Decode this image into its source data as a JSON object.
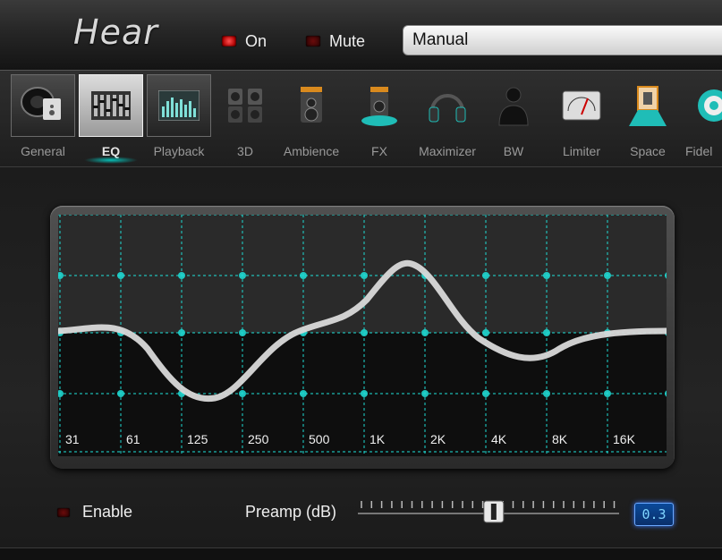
{
  "header": {
    "logo": "Hear",
    "on_label": "On",
    "mute_label": "Mute",
    "preset_value": "Manual"
  },
  "tabs": [
    {
      "label": "General",
      "icon": "speaker-disc-icon"
    },
    {
      "label": "EQ",
      "icon": "eq-sliders-icon"
    },
    {
      "label": "Playback",
      "icon": "spectrum-display-icon"
    },
    {
      "label": "3D",
      "icon": "surround-speakers-icon"
    },
    {
      "label": "Ambience",
      "icon": "speaker-room-icon"
    },
    {
      "label": "FX",
      "icon": "speaker-glow-icon"
    },
    {
      "label": "Maximizer",
      "icon": "headphones-icon"
    },
    {
      "label": "BW",
      "icon": "person-silhouette-icon"
    },
    {
      "label": "Limiter",
      "icon": "vu-meter-icon"
    },
    {
      "label": "Space",
      "icon": "room-space-icon"
    },
    {
      "label": "Fidel",
      "icon": "target-icon"
    }
  ],
  "active_tab": "EQ",
  "eq": {
    "bands": [
      "31",
      "61",
      "125",
      "250",
      "500",
      "1K",
      "2K",
      "4K",
      "8K",
      "16K"
    ],
    "curve_color": "#d9d9d9",
    "grid_color": "#1fd6cf"
  },
  "footer": {
    "enable_label": "Enable",
    "preamp_label": "Preamp (dB)",
    "preamp_value": "0.3",
    "preamp_level": 0.52
  }
}
